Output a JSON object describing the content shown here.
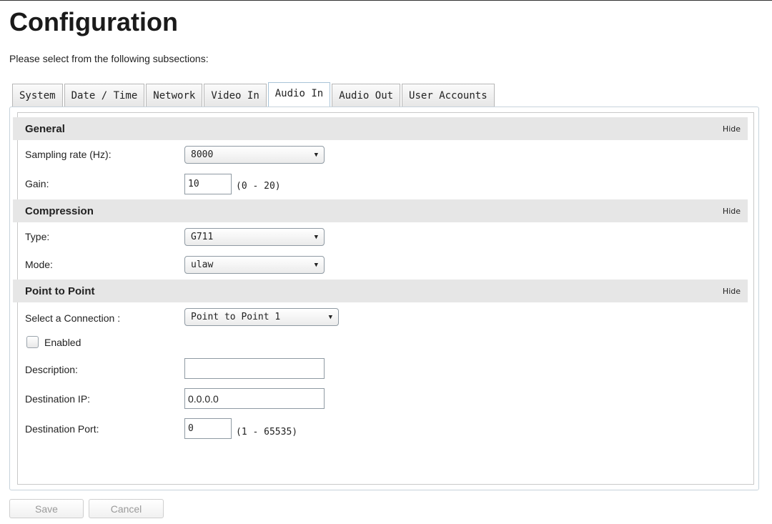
{
  "page": {
    "title": "Configuration",
    "intro": "Please select from the following subsections:"
  },
  "tabs": [
    {
      "label": "System"
    },
    {
      "label": "Date / Time"
    },
    {
      "label": "Network"
    },
    {
      "label": "Video In"
    },
    {
      "label": "Audio In",
      "active": true
    },
    {
      "label": "Audio Out"
    },
    {
      "label": "User Accounts"
    }
  ],
  "sections": {
    "general": {
      "title": "General",
      "hide": "Hide"
    },
    "compression": {
      "title": "Compression",
      "hide": "Hide"
    },
    "p2p": {
      "title": "Point to Point",
      "hide": "Hide"
    }
  },
  "fields": {
    "sampling_rate": {
      "label": "Sampling rate (Hz):",
      "value": "8000"
    },
    "gain": {
      "label": "Gain:",
      "value": "10",
      "range": "(0 - 20)"
    },
    "type": {
      "label": "Type:",
      "value": "G711"
    },
    "mode": {
      "label": "Mode:",
      "value": "ulaw"
    },
    "connection": {
      "label": "Select a Connection :",
      "value": "Point to Point 1"
    },
    "enabled": {
      "label": "Enabled",
      "checked": false
    },
    "description": {
      "label": "Description:",
      "value": ""
    },
    "dest_ip": {
      "label": "Destination IP:",
      "value": "0.0.0.0"
    },
    "dest_port": {
      "label": "Destination Port:",
      "value": "0",
      "range": "(1 - 65535)"
    }
  },
  "buttons": {
    "save": "Save",
    "cancel": "Cancel"
  },
  "icons": {
    "dropdown": "chevron-down-icon",
    "checkbox": "checkbox-icon"
  }
}
